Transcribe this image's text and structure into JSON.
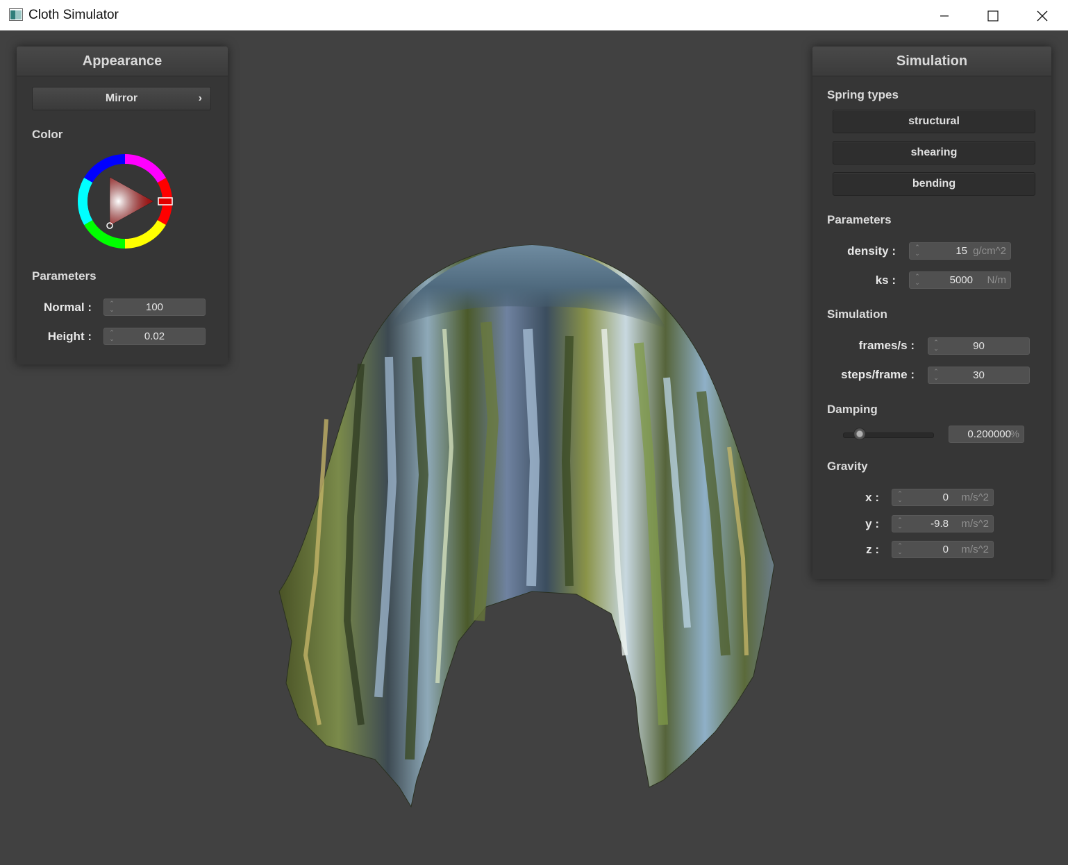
{
  "window": {
    "title": "Cloth Simulator",
    "icons": [
      "app-icon",
      "minimize-icon",
      "maximize-icon",
      "close-icon"
    ]
  },
  "appearance": {
    "header": "Appearance",
    "shader_select": "Mirror",
    "color_label": "Color",
    "color_value": "#ff0000",
    "parameters_label": "Parameters",
    "normal_label": "Normal :",
    "normal_value": "100",
    "height_label": "Height :",
    "height_value": "0.02"
  },
  "simulation": {
    "header": "Simulation",
    "spring_types_label": "Spring types",
    "spring_types": [
      "structural",
      "shearing",
      "bending"
    ],
    "parameters_label": "Parameters",
    "density_label": "density :",
    "density_value": "15",
    "density_unit": "g/cm^2",
    "ks_label": "ks :",
    "ks_value": "5000",
    "ks_unit": "N/m",
    "simulation_label": "Simulation",
    "fps_label": "frames/s :",
    "fps_value": "90",
    "steps_label": "steps/frame :",
    "steps_value": "30",
    "damping_label": "Damping",
    "damping_value": "0.200000",
    "damping_unit": "%",
    "damping_fraction": 0.2,
    "gravity_label": "Gravity",
    "gravity_x_label": "x :",
    "gravity_x_value": "0",
    "gravity_y_label": "y :",
    "gravity_y_value": "-9.8",
    "gravity_z_label": "z :",
    "gravity_z_value": "0",
    "gravity_unit": "m/s^2"
  }
}
